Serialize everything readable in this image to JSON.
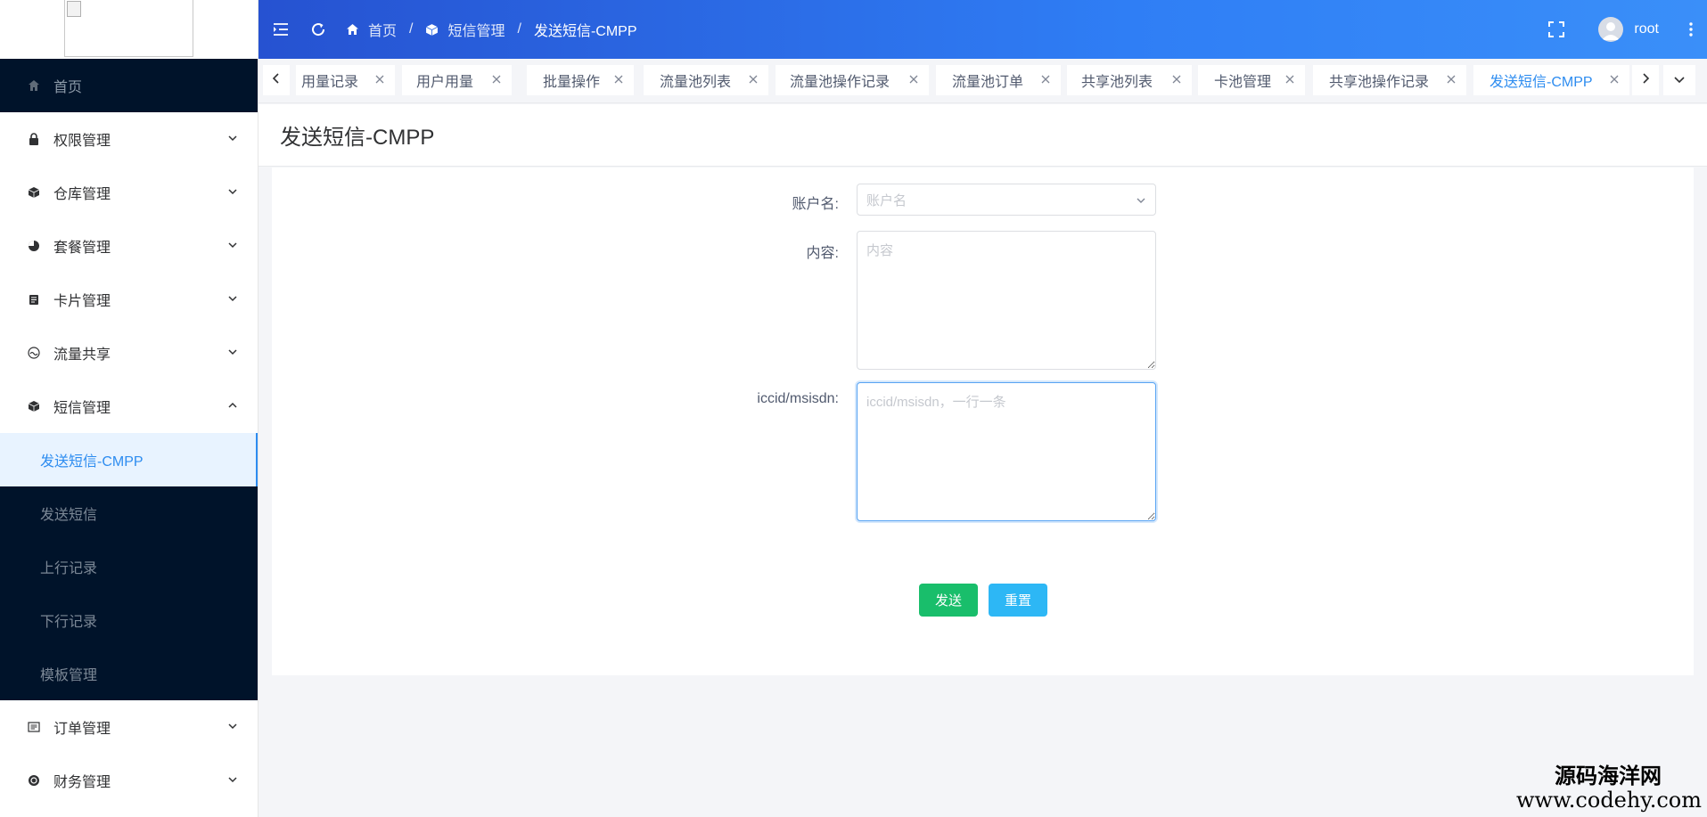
{
  "header": {
    "breadcrumb": [
      "首页",
      "短信管理",
      "发送短信-CMPP"
    ],
    "username": "root"
  },
  "sidebar": {
    "home": "首页",
    "items": [
      {
        "label": "权限管理"
      },
      {
        "label": "仓库管理"
      },
      {
        "label": "套餐管理"
      },
      {
        "label": "卡片管理"
      },
      {
        "label": "流量共享"
      },
      {
        "label": "短信管理"
      }
    ],
    "sms_children": [
      "发送短信-CMPP",
      "发送短信",
      "上行记录",
      "下行记录",
      "模板管理"
    ],
    "bottom_items": [
      {
        "label": "订单管理"
      },
      {
        "label": "财务管理"
      }
    ]
  },
  "tabs": [
    "用量记录",
    "用户用量",
    "批量操作",
    "流量池列表",
    "流量池操作记录",
    "流量池订单",
    "共享池列表",
    "卡池管理",
    "共享池操作记录",
    "发送短信-CMPP"
  ],
  "page": {
    "title": "发送短信-CMPP"
  },
  "form": {
    "account_label": "账户名:",
    "account_placeholder": "账户名",
    "content_label": "内容:",
    "content_placeholder": "内容",
    "iccid_label": "iccid/msisdn:",
    "iccid_placeholder": "iccid/msisdn，一行一条",
    "send_label": "发送",
    "reset_label": "重置"
  },
  "watermark": {
    "line1": "源码海洋网",
    "line2": "www.codehy.com"
  },
  "colors": {
    "header_start": "#2652d1",
    "header_end": "#3a8ff9",
    "sidebar_dark": "#00132a",
    "active_blue": "#2d8cf0",
    "send_green": "#19be6b",
    "reset_cyan": "#2db7f5"
  },
  "icons": {
    "header": [
      "menu-collapse-icon",
      "refresh-icon",
      "fullscreen-icon",
      "more-vertical-icon"
    ],
    "sidebar": [
      "home-icon",
      "lock-icon",
      "cube-icon",
      "pie-icon",
      "card-icon",
      "share-icon",
      "cube-icon",
      "list-icon",
      "coin-icon"
    ]
  }
}
